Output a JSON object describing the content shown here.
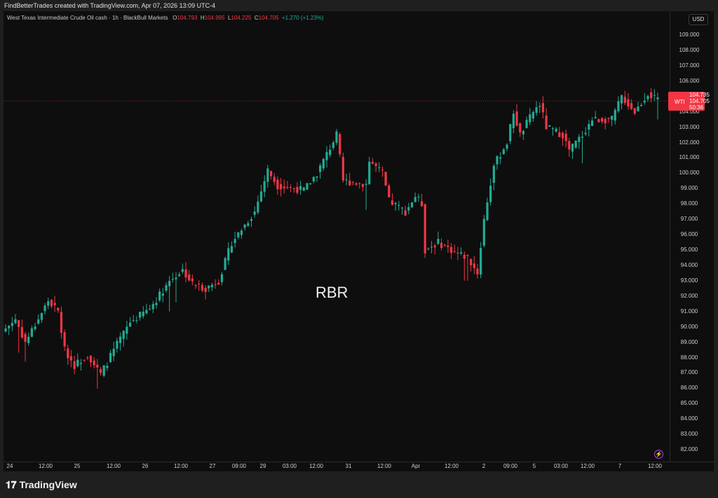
{
  "credit": "FindBetterTrades created with TradingView.com, Apr 07, 2026 13:09 UTC-4",
  "legend": {
    "symbol": "West Texas Intermediate Crude Oil cash · 1h · BlackBull Markets",
    "o_label": "O",
    "o": "104.793",
    "h_label": "H",
    "h": "104.995",
    "l_label": "L",
    "l": "104.225",
    "c_label": "C",
    "c": "104.705",
    "change": "+1.270 (+1.23%)"
  },
  "currency": "USD",
  "annotation": "RBR",
  "price_tag": {
    "symbol": "WTI",
    "high": "104.735",
    "last": "104.705",
    "countdown": "50:36"
  },
  "logo": "TradingView",
  "colors": {
    "up": "#22ab94",
    "down": "#f23645",
    "annotation": "#f0f0f0"
  },
  "chart_data": {
    "type": "candlestick",
    "title": "West Texas Intermediate Crude Oil cash · 1h",
    "ylim": [
      81.5,
      109.5
    ],
    "y_ticks": [
      "109.000",
      "108.000",
      "107.000",
      "106.000",
      "105.000",
      "104.000",
      "103.000",
      "102.000",
      "101.000",
      "100.000",
      "99.000",
      "98.000",
      "97.000",
      "96.000",
      "95.000",
      "94.000",
      "93.000",
      "92.000",
      "91.000",
      "90.000",
      "89.000",
      "88.000",
      "87.000",
      "86.000",
      "85.000",
      "84.000",
      "83.000",
      "82.000"
    ],
    "x_ticks": [
      "24",
      "12:00",
      "25",
      "12:00",
      "26",
      "12:00",
      "27",
      "09:00",
      "29",
      "03:00",
      "12:00",
      "31",
      "12:00",
      "Apr",
      "12:00",
      "2",
      "09:00",
      "5",
      "03:00",
      "12:00",
      "7",
      "12:00"
    ],
    "candle_count": 200,
    "close_path": [
      [
        0,
        89.9
      ],
      [
        3,
        90.5
      ],
      [
        6,
        89.0
      ],
      [
        13,
        91.7
      ],
      [
        16,
        91.0
      ],
      [
        18,
        88.5
      ],
      [
        21,
        87.5
      ],
      [
        25,
        88.2
      ],
      [
        29,
        86.9
      ],
      [
        33,
        88.5
      ],
      [
        38,
        90.3
      ],
      [
        44,
        91.2
      ],
      [
        50,
        93.0
      ],
      [
        54,
        93.7
      ],
      [
        57,
        92.8
      ],
      [
        61,
        92.5
      ],
      [
        65,
        93.0
      ],
      [
        69,
        95.5
      ],
      [
        76,
        97.5
      ],
      [
        80,
        100.2
      ],
      [
        83,
        99.2
      ],
      [
        91,
        98.9
      ],
      [
        95,
        100.0
      ],
      [
        101,
        102.5
      ],
      [
        103,
        99.5
      ],
      [
        110,
        99.3
      ],
      [
        111,
        100.8
      ],
      [
        115,
        100.0
      ],
      [
        117,
        98.2
      ],
      [
        122,
        97.5
      ],
      [
        125,
        98.5
      ],
      [
        127,
        98.0
      ],
      [
        128,
        95.0
      ],
      [
        132,
        95.5
      ],
      [
        136,
        95.0
      ],
      [
        141,
        94.5
      ],
      [
        144,
        93.5
      ],
      [
        146,
        97.0
      ],
      [
        149,
        100.5
      ],
      [
        153,
        102.0
      ],
      [
        155,
        104.0
      ],
      [
        157,
        102.5
      ],
      [
        161,
        104.0
      ],
      [
        163,
        104.5
      ],
      [
        165,
        103.0
      ],
      [
        170,
        102.5
      ],
      [
        172,
        101.5
      ],
      [
        176,
        102.5
      ],
      [
        179,
        103.5
      ],
      [
        185,
        103.5
      ],
      [
        188,
        105.0
      ],
      [
        192,
        104.0
      ],
      [
        196,
        105.2
      ],
      [
        199,
        104.7
      ]
    ]
  }
}
